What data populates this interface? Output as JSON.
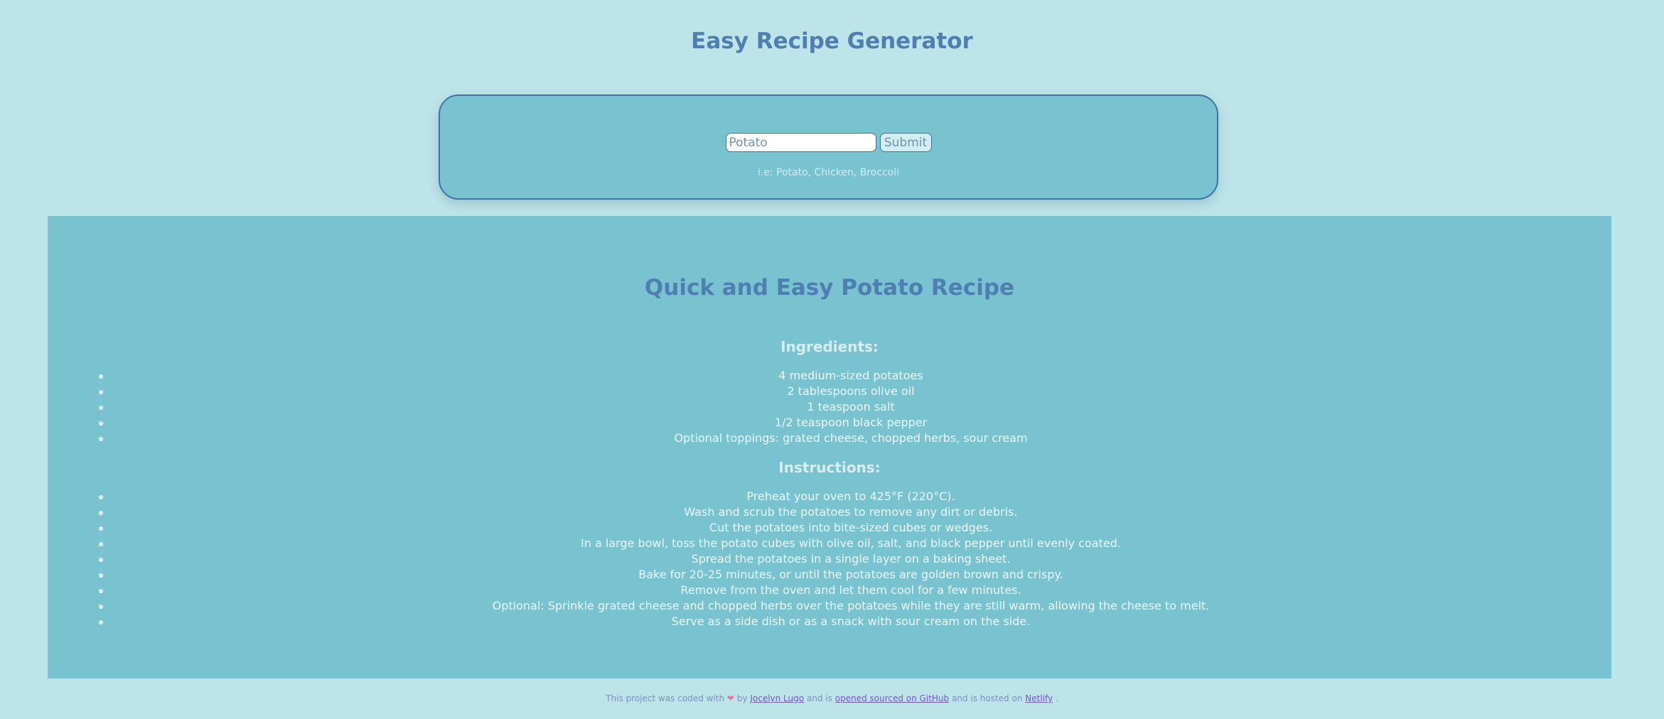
{
  "header": {
    "title": "Easy Recipe Generator"
  },
  "search": {
    "value": "Potato",
    "submit_label": "Submit",
    "hint": "i.e: Potato, Chicken, Broccoli"
  },
  "recipe": {
    "title": "Quick and Easy Potato Recipe",
    "ingredients_heading": "Ingredients:",
    "ingredients": [
      "4 medium-sized potatoes",
      "2 tablespoons olive oil",
      "1 teaspoon salt",
      "1/2 teaspoon black pepper",
      "Optional toppings: grated cheese, chopped herbs, sour cream"
    ],
    "instructions_heading": "Instructions:",
    "instructions": [
      "Preheat your oven to 425°F (220°C).",
      "Wash and scrub the potatoes to remove any dirt or debris.",
      "Cut the potatoes into bite-sized cubes or wedges.",
      "In a large bowl, toss the potato cubes with olive oil, salt, and black pepper until evenly coated.",
      "Spread the potatoes in a single layer on a baking sheet.",
      "Bake for 20-25 minutes, or until the potatoes are golden brown and crispy.",
      "Remove from the oven and let them cool for a few minutes.",
      "Optional: Sprinkle grated cheese and chopped herbs over the potatoes while they are still warm, allowing the cheese to melt.",
      "Serve as a side dish or as a snack with sour cream on the side."
    ]
  },
  "footer": {
    "text_before": "This project was coded with",
    "heart_icon": "heart-icon",
    "by_text": "by",
    "author_link": "Jocelyn Lugo",
    "and_is_text": "and is",
    "github_link": "opened sourced on GitHub",
    "hosted_text": "and is hosted on",
    "netlify_link": "Netlify",
    "end_text": "."
  },
  "colors": {
    "background": "#bde4e8",
    "panel": "#79c3d0",
    "title": "#4f7fb2",
    "border": "#3f73a8",
    "link": "#6f58c4",
    "heart": "#e57a9f"
  }
}
